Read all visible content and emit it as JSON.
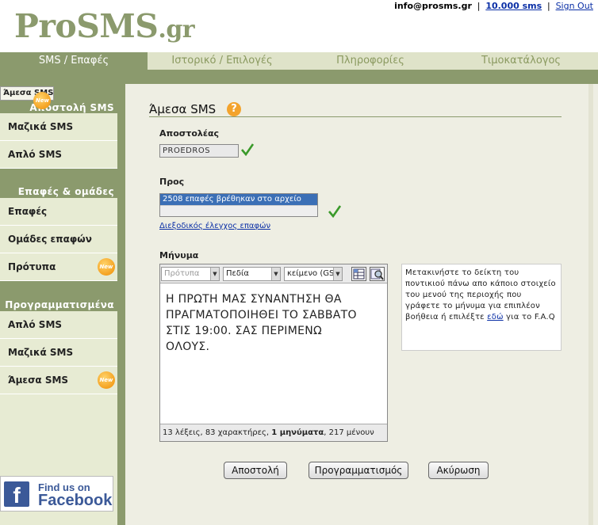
{
  "header": {
    "email": "info@prosms.gr",
    "credits": "10.000 sms",
    "separator": "|",
    "signout": "Sign Out",
    "logo_main": "ProSMS",
    "logo_tld": ".gr"
  },
  "nav": {
    "tabs": [
      {
        "label": "SMS / Επαφές",
        "active": true
      },
      {
        "label": "Ιστορικό / Επιλογές",
        "active": false
      },
      {
        "label": "Πληροφορίες",
        "active": false
      },
      {
        "label": "Τιμοκατάλογος",
        "active": false
      }
    ]
  },
  "sidebar": {
    "section1": "Αποστολή SMS",
    "items1": [
      "Μαζικά SMS",
      "Απλό SMS",
      "Άμεσα SMS"
    ],
    "section2": "Επαφές & ομάδες",
    "items2": [
      "Επαφές",
      "Ομάδες επαφών",
      "Πρότυπα"
    ],
    "section3": "Προγραμματισμένα",
    "items3": [
      "Απλό SMS",
      "Μαζικά SMS",
      "Άμεσα SMS"
    ],
    "new_badge": "New",
    "facebook_line1": "Find us on",
    "facebook_line2": "Facebook"
  },
  "main": {
    "title": "Άμεσα SMS",
    "help_icon": "?",
    "sender_label": "Αποστολέας",
    "sender_value": "PROEDROS",
    "to_label": "Προς",
    "to_selected": "2508 επαφές βρέθηκαν στο αρχείο",
    "check_link": "Διεξοδικός έλεγχος επαφών",
    "message_label": "Μήνυμα",
    "select_templates": "Πρότυπα",
    "select_fields": "Πεδία",
    "select_encoding": "κείμενο (GSM)",
    "message_text": "Η ΠΡΩΤΗ ΜΑΣ ΣΥΝΑΝΤΗΣΗ ΘΑ\nΠΡΑΓΜΑΤΟΠΟΙΗΘΕΙ ΤΟ ΣΑΒΒΑΤΟ\nΣΤΙΣ 19:00. ΣΑΣ ΠΕΡΙΜΕΝΩ\nΟΛΟΥΣ.",
    "counter_pre": "13 λέξεις, 83 χαρακτήρες, ",
    "counter_bold": "1 μηνύματα",
    "counter_post": ", 217 μένουν",
    "hint_text": "Μετακινήστε το δείκτη του ποντικιού πάνω απο κάποιο στοιχείο του μενού της περιοχής που γράφετε το μήνυμα για επιπλέον βοήθεια ή επιλέξτε ",
    "hint_link": "εδώ",
    "hint_after": " για το F.A.Q",
    "btn_send": "Αποστολή",
    "btn_schedule": "Προγραμματισμός",
    "btn_cancel": "Ακύρωση"
  },
  "colors": {
    "brand": "#8b9a6d",
    "nav_bg": "#dfe3c9",
    "sidebar_bg": "#e7ebd3",
    "main_bg": "#eeeee3",
    "link": "#0a2fa6",
    "selected_row": "#3b6fb6"
  }
}
